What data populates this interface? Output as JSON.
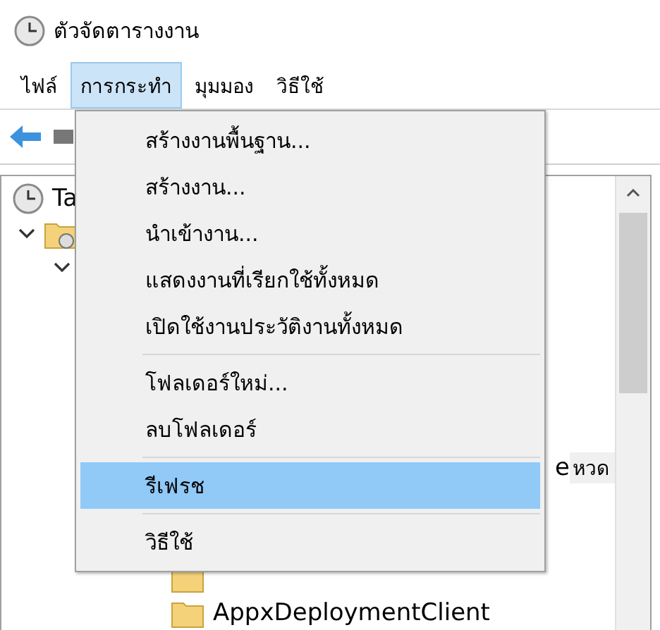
{
  "window": {
    "title": "ตัวจัดตารางงาน"
  },
  "menu_bar": [
    {
      "label": "ไฟล์",
      "selected": false
    },
    {
      "label": "การกระทำ",
      "selected": true
    },
    {
      "label": "มุมมอง",
      "selected": false
    },
    {
      "label": "วิธีใช้",
      "selected": false
    }
  ],
  "dropdown": [
    {
      "kind": "item",
      "label": "สร้างงานพื้นฐาน...",
      "selected": false
    },
    {
      "kind": "item",
      "label": "สร้างงาน...",
      "selected": false
    },
    {
      "kind": "item",
      "label": "นำเข้างาน...",
      "selected": false
    },
    {
      "kind": "item",
      "label": "แสดงงานที่เรียกใช้ทั้งหมด",
      "selected": false
    },
    {
      "kind": "item",
      "label": "เปิดใช้งานประวัติงานทั้งหมด",
      "selected": false
    },
    {
      "kind": "separator"
    },
    {
      "kind": "item",
      "label": "โฟลเดอร์ใหม่...",
      "selected": false
    },
    {
      "kind": "item",
      "label": "ลบโฟลเดอร์",
      "selected": false
    },
    {
      "kind": "separator"
    },
    {
      "kind": "item",
      "label": "รีเฟรช",
      "selected": true
    },
    {
      "kind": "separator"
    },
    {
      "kind": "item",
      "label": "วิธีใช้",
      "selected": false
    }
  ],
  "tree": [
    {
      "label": "Ta",
      "children": [
        {
          "expanded": true,
          "children": [
            {
              "expanded": true
            }
          ]
        }
      ]
    }
  ],
  "right_fragment": {
    "text": "e",
    "tag": "หวด"
  },
  "folders": [
    {
      "kind": "covered"
    },
    {
      "kind": "folder",
      "label": "AppxDeploymentClient"
    }
  ]
}
